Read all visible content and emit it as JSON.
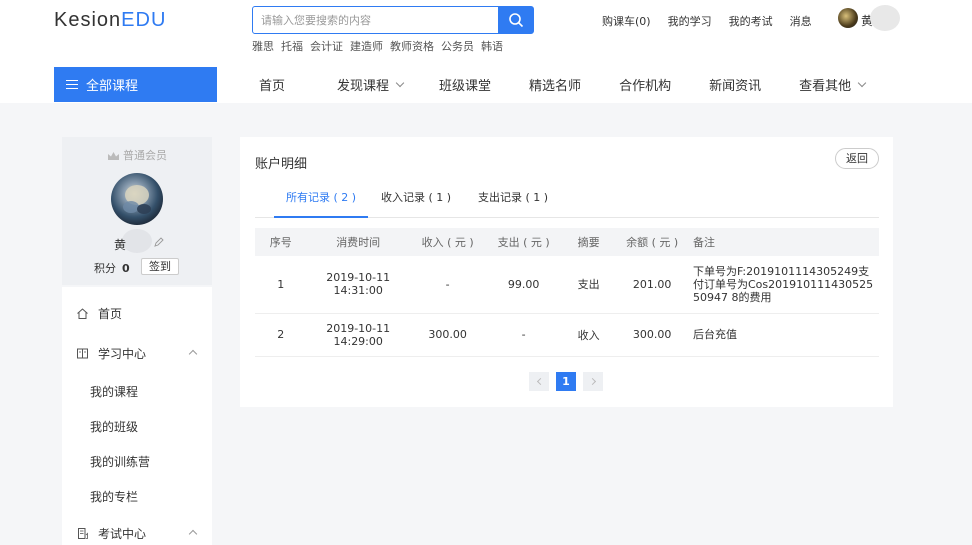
{
  "header": {
    "logo_main": "Kesion",
    "logo_accent": "EDU",
    "search_placeholder": "请输入您要搜索的内容",
    "hot_words": [
      "雅思",
      "托福",
      "会计证",
      "建造师",
      "教师资格",
      "公务员",
      "韩语"
    ],
    "links": [
      "购课车(0)",
      "我的学习",
      "我的考试",
      "消息"
    ],
    "user_name": "黄"
  },
  "nav": {
    "all_courses": "全部课程",
    "items": [
      {
        "label": "首页",
        "dropdown": false
      },
      {
        "label": "发现课程",
        "dropdown": true
      },
      {
        "label": "班级课堂",
        "dropdown": false
      },
      {
        "label": "精选名师",
        "dropdown": false
      },
      {
        "label": "合作机构",
        "dropdown": false
      },
      {
        "label": "新闻资讯",
        "dropdown": false
      },
      {
        "label": "查看其他",
        "dropdown": true
      }
    ]
  },
  "sidebar": {
    "member_level": "普通会员",
    "user_name": "黄",
    "points_label": "积分",
    "points_value": "0",
    "checkin_label": "签到",
    "menu": {
      "home": "首页",
      "study_center": "学习中心",
      "study_items": [
        "我的课程",
        "我的班级",
        "我的训练营",
        "我的专栏"
      ],
      "exam_center": "考试中心"
    }
  },
  "main": {
    "title": "账户明细",
    "back_label": "返回",
    "tabs": [
      {
        "label": "所有记录 ( 2 )",
        "active": true
      },
      {
        "label": "收入记录 ( 1 )",
        "active": false
      },
      {
        "label": "支出记录 ( 1 )",
        "active": false
      }
    ],
    "table": {
      "headers": [
        "序号",
        "消费时间",
        "收入 ( 元 )",
        "支出 ( 元 )",
        "摘要",
        "余额 ( 元 )",
        "备注"
      ],
      "rows": [
        {
          "no": "1",
          "date": "2019-10-11",
          "time": "14:31:00",
          "income": "-",
          "expense": "99.00",
          "summary": "支出",
          "balance": "201.00",
          "remark": "下单号为F:2019101114305249支付订单号为Cos20191011143052550947 8的费用"
        },
        {
          "no": "2",
          "date": "2019-10-11",
          "time": "14:29:00",
          "income": "300.00",
          "expense": "-",
          "summary": "收入",
          "balance": "300.00",
          "remark": "后台充值"
        }
      ]
    },
    "pagination": {
      "current": "1"
    }
  },
  "colors": {
    "accent": "#2f7bf2",
    "page_bg": "#f5f6f8"
  }
}
